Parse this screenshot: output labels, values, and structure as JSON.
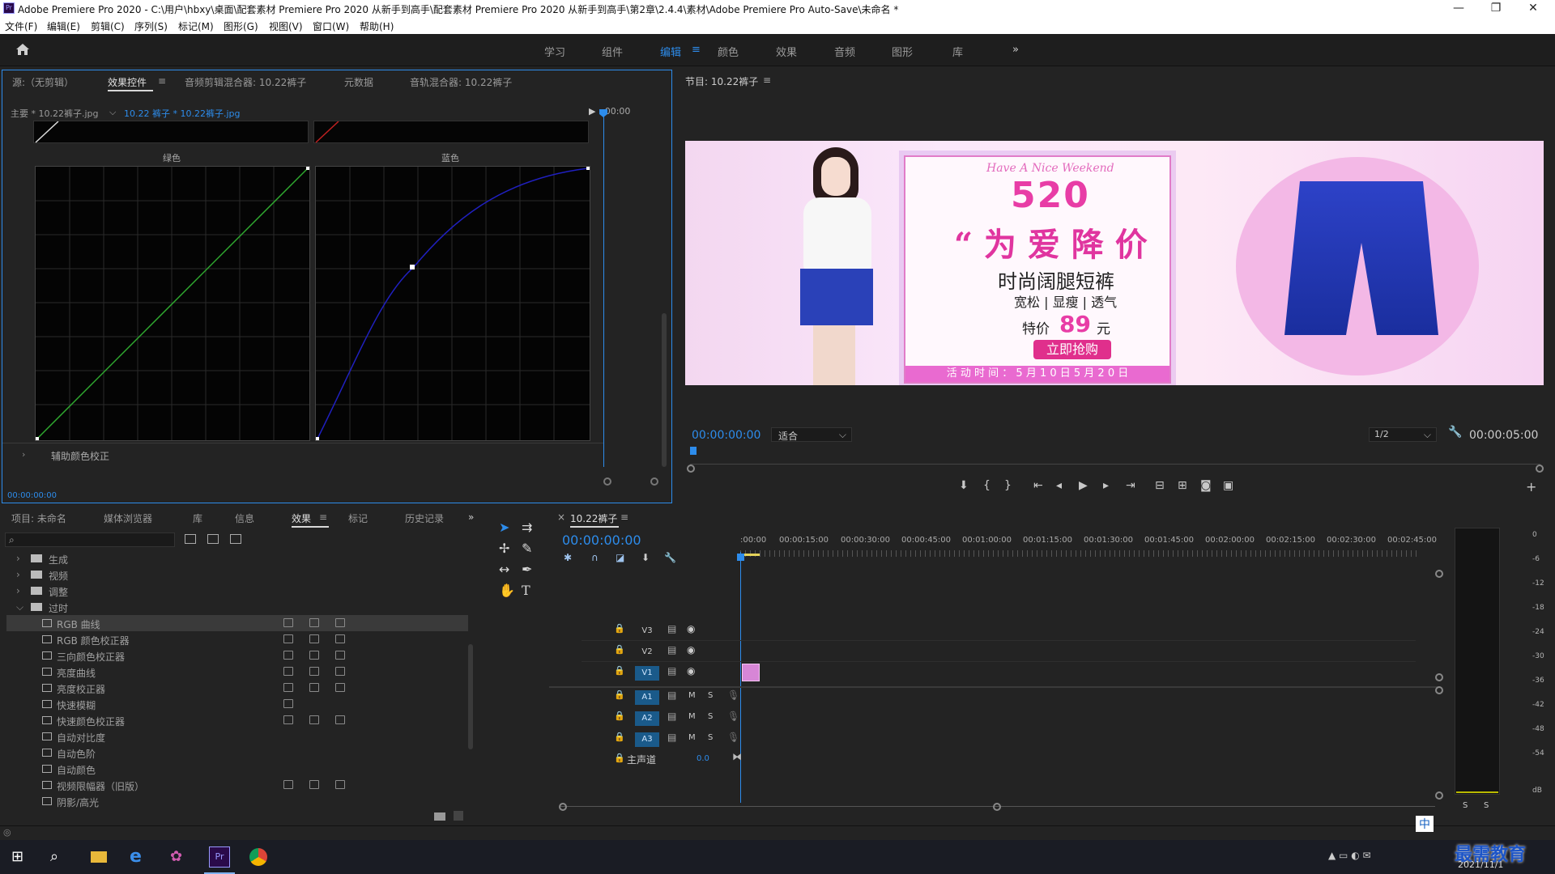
{
  "window": {
    "title": "Adobe Premiere Pro 2020 - C:\\用户\\hbxy\\桌面\\配套素材 Premiere Pro 2020 从新手到高手\\配套素材 Premiere Pro 2020 从新手到高手\\第2章\\2.4.4\\素材\\Adobe Premiere Pro Auto-Save\\未命名 *",
    "min": "—",
    "max": "❐",
    "close": "✕"
  },
  "menu": [
    "文件(F)",
    "编辑(E)",
    "剪辑(C)",
    "序列(S)",
    "标记(M)",
    "图形(G)",
    "视图(V)",
    "窗口(W)",
    "帮助(H)"
  ],
  "workspaces": [
    "学习",
    "组件",
    "编辑",
    "颜色",
    "效果",
    "音频",
    "图形",
    "库"
  ],
  "workspace_active": "编辑",
  "workspace_more": "»",
  "source_panel": {
    "tabs": [
      "源:（无剪辑）",
      "效果控件",
      "音频剪辑混合器: 10.22裤子",
      "元数据",
      "音轨混合器: 10.22裤子"
    ],
    "active_tab": "效果控件",
    "clip_master": "主要 * 10.22裤子.jpg",
    "clip_seq": "10.22 裤子 * 10.22裤子.jpg",
    "time_ruler": ":00:00",
    "curve_green_label": "绿色",
    "curve_blue_label": "蓝色",
    "secondary": "辅助颜色校正",
    "timecode": "00:00:00:00"
  },
  "program_panel": {
    "title": "节目: 10.22裤子",
    "timecode_left": "00:00:00:00",
    "fit": "适合",
    "quality": "1/2",
    "timecode_right": "00:00:05:00"
  },
  "banner": {
    "tagline": "Have A Nice Weekend",
    "big": "520",
    "quote": "“ 为 爱 降 价",
    "product": "时尚阔腿短裤",
    "features": "宽松 | 显瘦 | 透气",
    "price_prefix": "特价",
    "price": "89",
    "price_suffix": "元",
    "button": "立即抢购",
    "date_line": "活 动 时 间 ： 5 月 1 0 日   5 月 2 0 日"
  },
  "project_panel": {
    "tabs": [
      "项目: 未命名",
      "媒体浏览器",
      "库",
      "信息",
      "效果",
      "标记",
      "历史记录"
    ],
    "active_tab": "效果",
    "folders": [
      "生成",
      "视频",
      "调整",
      "过时"
    ],
    "items": [
      "RGB 曲线",
      "RGB 颜色校正器",
      "三向颜色校正器",
      "亮度曲线",
      "亮度校正器",
      "快速模糊",
      "快速颜色校正器",
      "自动对比度",
      "自动色阶",
      "自动颜色",
      "视频限幅器（旧版）",
      "阴影/高光"
    ]
  },
  "timeline": {
    "tab": "10.22裤子",
    "timecode": "00:00:00:00",
    "ruler": [
      ":00:00",
      "00:00:15:00",
      "00:00:30:00",
      "00:00:45:00",
      "00:01:00:00",
      "00:01:15:00",
      "00:01:30:00",
      "00:01:45:00",
      "00:02:00:00",
      "00:02:15:00",
      "00:02:30:00",
      "00:02:45:00"
    ],
    "video_tracks": [
      "V3",
      "V2",
      "V1"
    ],
    "audio_tracks": [
      "A1",
      "A2",
      "A3"
    ],
    "mute": "M",
    "solo": "S",
    "master": "主声道",
    "master_value": "0.0"
  },
  "meter": {
    "scale": [
      "0",
      "-6",
      "-12",
      "-18",
      "-24",
      "-30",
      "-36",
      "-42",
      "-48",
      "-54",
      "dB"
    ],
    "solo_l": "S",
    "solo_r": "S"
  },
  "taskbar": {
    "ime": "中",
    "date": "2021/11/1",
    "watermark": "最需教育"
  },
  "colors": {
    "accent": "#2d8ceb",
    "panel": "#232323",
    "green_curve": "#2fa82f",
    "blue_curve": "#2020c0",
    "clip": "#d786d6"
  }
}
